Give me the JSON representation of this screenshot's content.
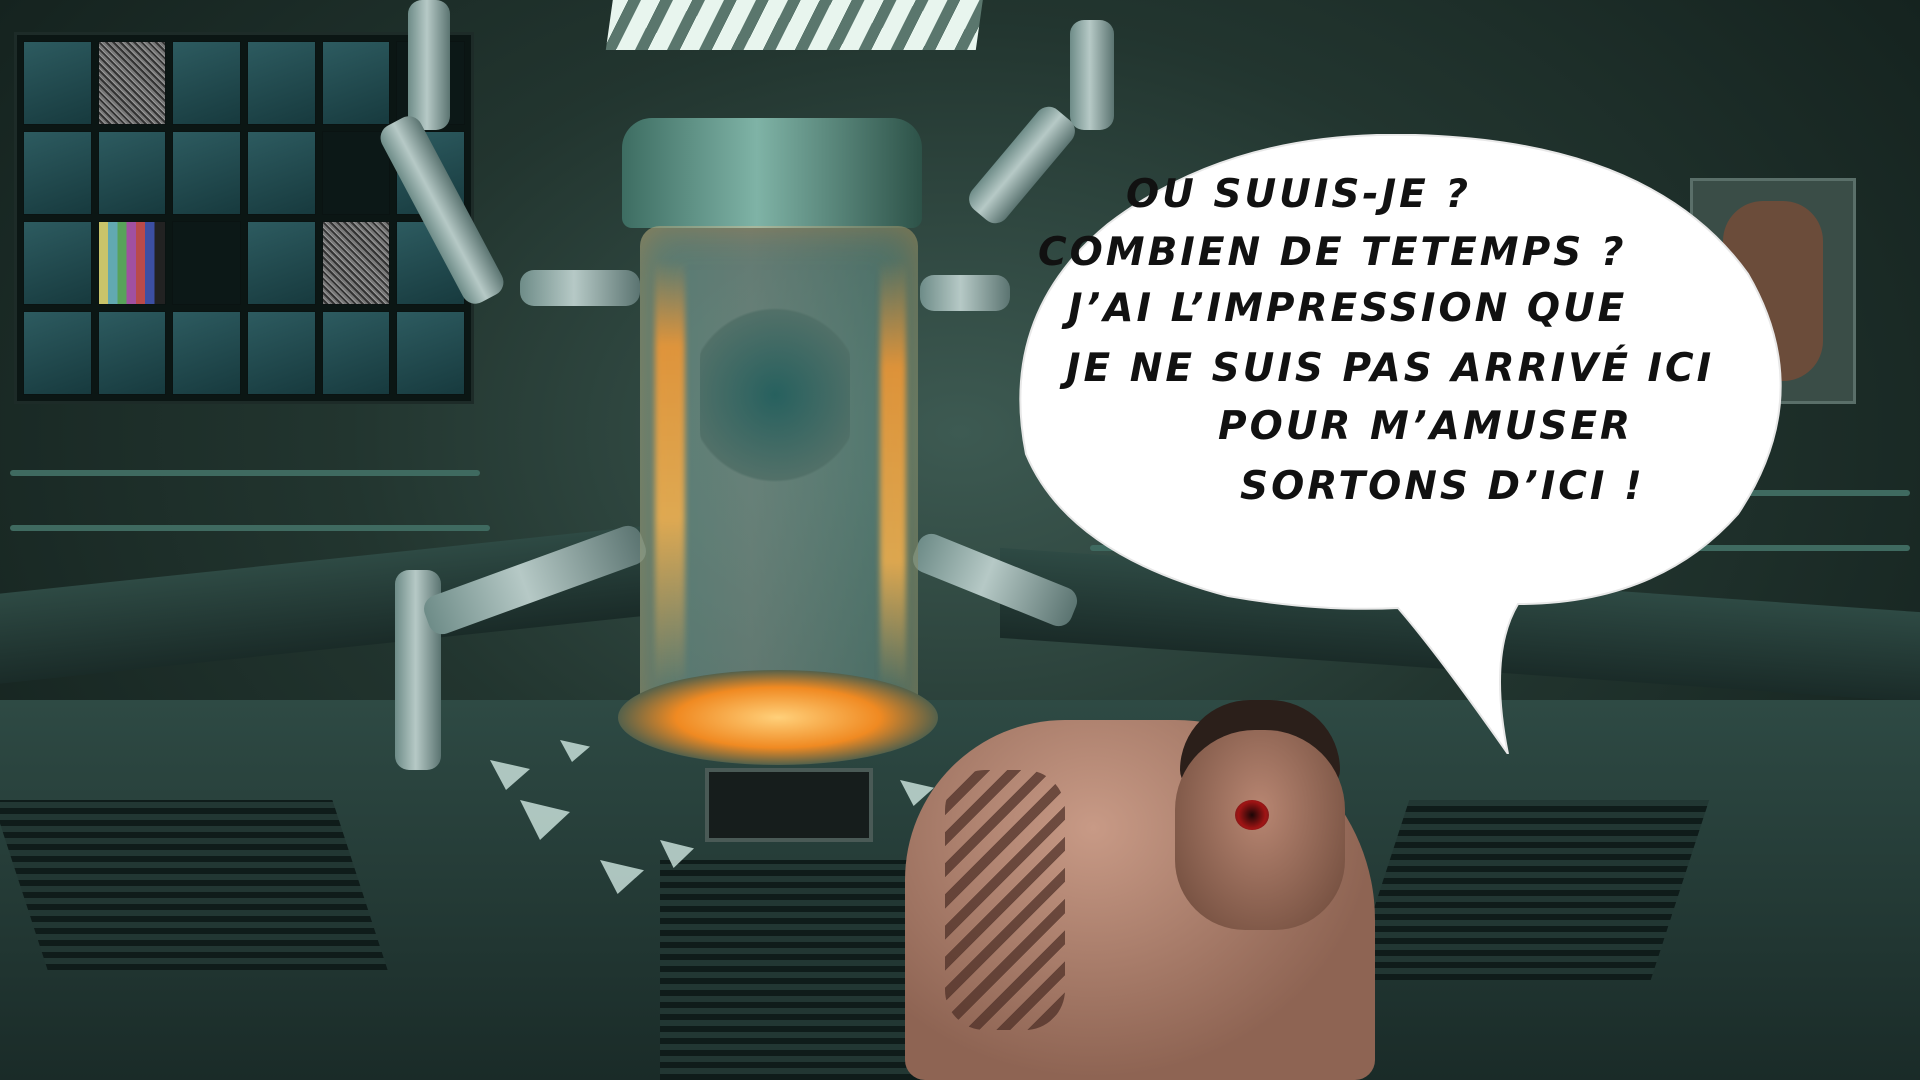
{
  "scene": {
    "speech_bubble": {
      "lines": [
        "OU SUUIS-JE ?",
        "COMBIEN DE TETEMPS ?",
        "J’AI L’IMPRESSION QUE",
        "JE NE SUIS PAS ARRIVÉ ICI",
        "POUR M’AMUSER",
        "SORTONS D’ICI !"
      ]
    },
    "colors": {
      "room_tint": "#2e4a44",
      "fire": "#ff9a2e",
      "bubble": "#ffffff",
      "text": "#111111"
    }
  }
}
